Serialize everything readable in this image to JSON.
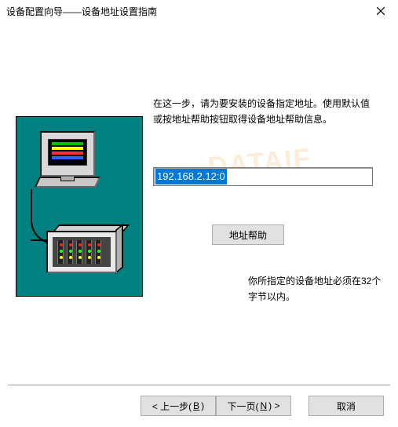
{
  "window": {
    "title": "设备配置向导——设备地址设置指南"
  },
  "instruction": "在这一步，请为要安装的设备指定地址。使用默认值或按地址帮助按钮取得设备地址帮助信息。",
  "address": {
    "value": "192.168.2.12:0"
  },
  "help_button": "地址帮助",
  "hint": "你所指定的设备地址必须在32个字节以内。",
  "footer": {
    "back_prefix": "< 上一步(",
    "back_key": "B",
    "back_suffix": ")",
    "next_prefix": "下一页(",
    "next_key": "N",
    "next_suffix": ") >",
    "cancel": "取消"
  },
  "watermark": "DATAIF"
}
